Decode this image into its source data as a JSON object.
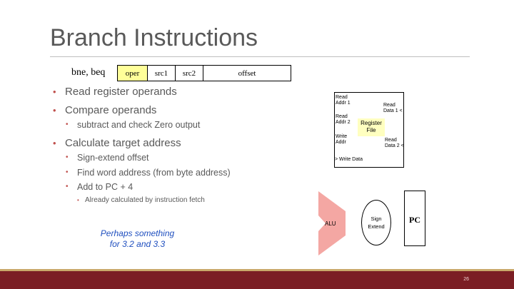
{
  "slide": {
    "title": "Branch Instructions",
    "page_number": "26"
  },
  "format": {
    "label": "bne, beq",
    "fields": [
      {
        "text": "oper",
        "highlight": "#ffff99"
      },
      {
        "text": "src1",
        "highlight": "#ffffff"
      },
      {
        "text": "src2",
        "highlight": "#ffffff"
      },
      {
        "text": "offset",
        "highlight": "#ffffff"
      }
    ]
  },
  "bullets": [
    {
      "level": 1,
      "text": "Read register operands"
    },
    {
      "level": 1,
      "text": "Compare operands"
    },
    {
      "level": 2,
      "text": "subtract and check Zero output"
    },
    {
      "level": 1,
      "text": "Calculate target address"
    },
    {
      "level": 2,
      "text": "Sign-extend offset"
    },
    {
      "level": 2,
      "text": "Find word address (from byte address)"
    },
    {
      "level": 2,
      "text": "Add to PC + 4"
    },
    {
      "level": 3,
      "text": "Already calculated by instruction fetch"
    }
  ],
  "note": {
    "line1": "Perhaps something",
    "line2": "for 3.2 and 3.3"
  },
  "diagram": {
    "register_file": {
      "read_addr_1": "Read\nAddr 1",
      "read_addr_2": "Read\nAddr 2",
      "write_addr": "Write\nAddr",
      "write_data": "> Write Data",
      "read_data_1": "Read\nData 1 <",
      "read_data_2": "Read\nData 2 <",
      "core_label": "Register\nFile"
    },
    "alu_label": "ALU",
    "sign_extend_label": "Sign\nExtend",
    "pc_label": "PC"
  },
  "colors": {
    "bullet": "#c0504d",
    "footer": "#7b1e24",
    "footer_accent": "#c9a96a",
    "alu_fill": "#f4a7a3",
    "note_text": "#1f4fbf"
  }
}
